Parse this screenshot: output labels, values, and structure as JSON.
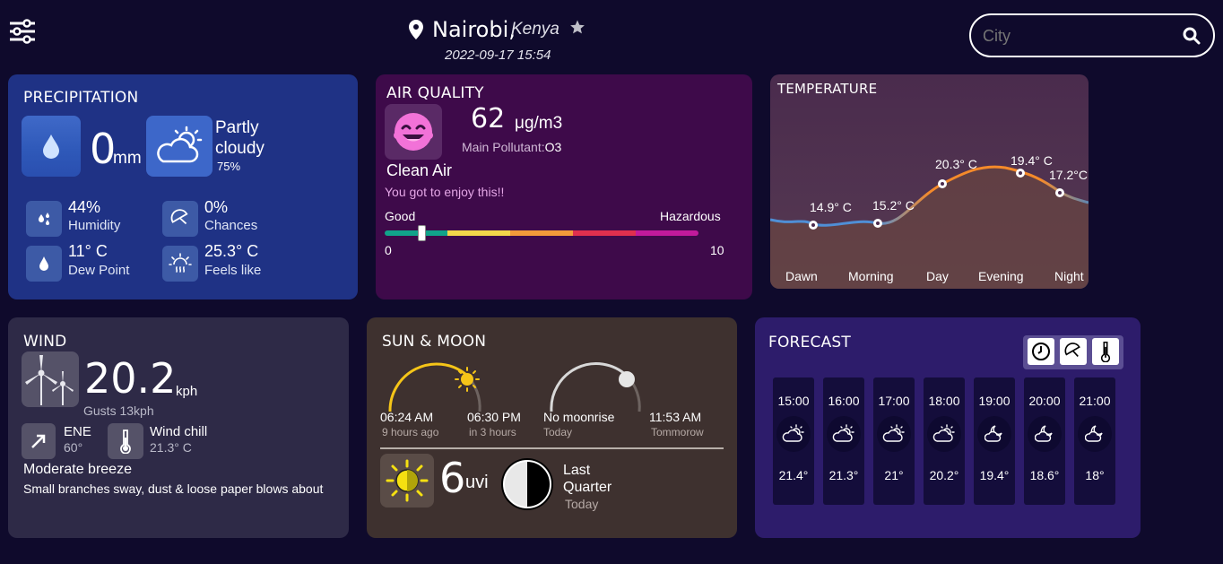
{
  "header": {
    "city": "Nairobi,",
    "country": "Kenya",
    "datetime": "2022-09-17 15:54",
    "search_placeholder": "City"
  },
  "precipitation": {
    "title": "PRECIPITATION",
    "amount": "0",
    "unit": "mm",
    "condition_line1": "Partly",
    "condition_line2": "cloudy",
    "condition_pct": "75%",
    "humidity_value": "44%",
    "humidity_label": "Humidity",
    "chances_value": "0%",
    "chances_label": "Chances",
    "dew_value": "11° C",
    "dew_label": "Dew Point",
    "feels_value": "25.3° C",
    "feels_label": "Feels like"
  },
  "air_quality": {
    "title": "AIR QUALITY",
    "value": "62",
    "unit": "μg/m3",
    "pollutant_label": "Main Pollutant:",
    "pollutant_value": "O3",
    "status": "Clean Air",
    "message": "You got to enjoy this!!",
    "scale_good": "Good",
    "scale_hazardous": "Hazardous",
    "scale_min": "0",
    "scale_max": "10",
    "level_fraction": 0.117
  },
  "temperature": {
    "title": "TEMPERATURE",
    "points": [
      {
        "period": "Dawn",
        "value": "14.9° C"
      },
      {
        "period": "Morning",
        "value": "15.2° C"
      },
      {
        "period": "Day",
        "value": "20.3° C"
      },
      {
        "period": "Evening",
        "value": "19.4° C"
      },
      {
        "period": "Night",
        "value": "17.2°C"
      }
    ]
  },
  "wind": {
    "title": "WIND",
    "speed": "20.2",
    "unit": "kph",
    "gusts": "Gusts 13kph",
    "direction": "ENE",
    "degrees": "60°",
    "chill_label": "Wind chill",
    "chill_value": "21.3° C",
    "description": "Moderate breeze",
    "detail": "Small branches sway, dust & loose paper blows about"
  },
  "sun_moon": {
    "title": "SUN & MOON",
    "sunrise_time": "06:24 AM",
    "sunrise_rel": "9 hours ago",
    "sunset_time": "06:30 PM",
    "sunset_rel": "in 3 hours",
    "moonrise_time": "No moonrise",
    "moonrise_rel": "Today",
    "moonset_time": "11:53 AM",
    "moonset_rel": "Tommorow",
    "uvi_value": "6",
    "uvi_unit": "uvi",
    "phase_line1": "Last",
    "phase_line2": "Quarter",
    "phase_when": "Today"
  },
  "forecast": {
    "title": "FORECAST",
    "hours": [
      {
        "time": "15:00",
        "temp": "21.4°",
        "icon": "cloud-sun-icon"
      },
      {
        "time": "16:00",
        "temp": "21.3°",
        "icon": "cloud-sun-icon"
      },
      {
        "time": "17:00",
        "temp": "21°",
        "icon": "cloud-sun-icon"
      },
      {
        "time": "18:00",
        "temp": "20.2°",
        "icon": "cloud-sun-icon"
      },
      {
        "time": "19:00",
        "temp": "19.4°",
        "icon": "cloud-moon-icon"
      },
      {
        "time": "20:00",
        "temp": "18.6°",
        "icon": "cloud-moon-icon"
      },
      {
        "time": "21:00",
        "temp": "18°",
        "icon": "cloud-moon-icon"
      }
    ]
  },
  "colors": {
    "background": "#0f0a2c",
    "precipitation_card": "#1f3285",
    "air_card": "#3e0a4a",
    "temperature_card": "#4b2a48",
    "wind_card": "#2e2a47",
    "sun_card": "#3e312f",
    "forecast_card": "#2d1c6b"
  }
}
